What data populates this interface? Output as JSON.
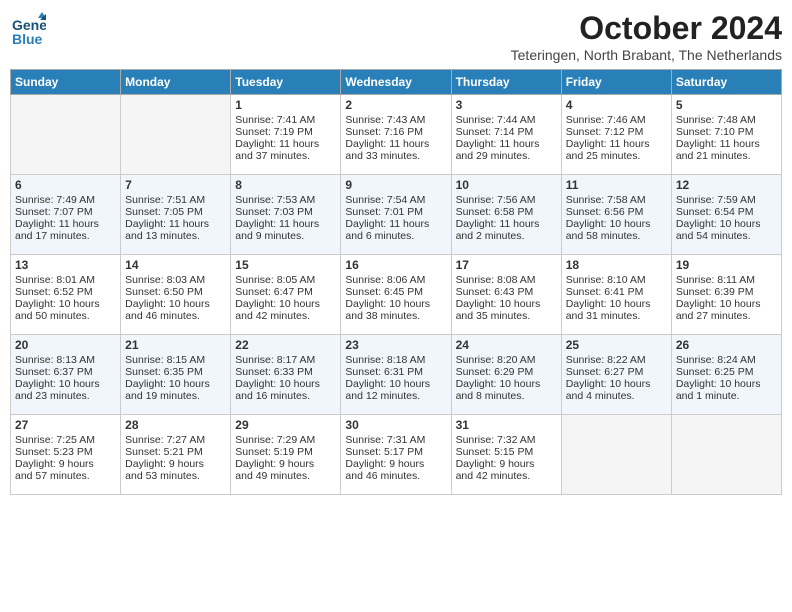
{
  "header": {
    "logo_line1": "General",
    "logo_line2": "Blue",
    "month": "October 2024",
    "location": "Teteringen, North Brabant, The Netherlands"
  },
  "days_of_week": [
    "Sunday",
    "Monday",
    "Tuesday",
    "Wednesday",
    "Thursday",
    "Friday",
    "Saturday"
  ],
  "weeks": [
    [
      {
        "day": "",
        "content": ""
      },
      {
        "day": "",
        "content": ""
      },
      {
        "day": "1",
        "content": "Sunrise: 7:41 AM\nSunset: 7:19 PM\nDaylight: 11 hours\nand 37 minutes."
      },
      {
        "day": "2",
        "content": "Sunrise: 7:43 AM\nSunset: 7:16 PM\nDaylight: 11 hours\nand 33 minutes."
      },
      {
        "day": "3",
        "content": "Sunrise: 7:44 AM\nSunset: 7:14 PM\nDaylight: 11 hours\nand 29 minutes."
      },
      {
        "day": "4",
        "content": "Sunrise: 7:46 AM\nSunset: 7:12 PM\nDaylight: 11 hours\nand 25 minutes."
      },
      {
        "day": "5",
        "content": "Sunrise: 7:48 AM\nSunset: 7:10 PM\nDaylight: 11 hours\nand 21 minutes."
      }
    ],
    [
      {
        "day": "6",
        "content": "Sunrise: 7:49 AM\nSunset: 7:07 PM\nDaylight: 11 hours\nand 17 minutes."
      },
      {
        "day": "7",
        "content": "Sunrise: 7:51 AM\nSunset: 7:05 PM\nDaylight: 11 hours\nand 13 minutes."
      },
      {
        "day": "8",
        "content": "Sunrise: 7:53 AM\nSunset: 7:03 PM\nDaylight: 11 hours\nand 9 minutes."
      },
      {
        "day": "9",
        "content": "Sunrise: 7:54 AM\nSunset: 7:01 PM\nDaylight: 11 hours\nand 6 minutes."
      },
      {
        "day": "10",
        "content": "Sunrise: 7:56 AM\nSunset: 6:58 PM\nDaylight: 11 hours\nand 2 minutes."
      },
      {
        "day": "11",
        "content": "Sunrise: 7:58 AM\nSunset: 6:56 PM\nDaylight: 10 hours\nand 58 minutes."
      },
      {
        "day": "12",
        "content": "Sunrise: 7:59 AM\nSunset: 6:54 PM\nDaylight: 10 hours\nand 54 minutes."
      }
    ],
    [
      {
        "day": "13",
        "content": "Sunrise: 8:01 AM\nSunset: 6:52 PM\nDaylight: 10 hours\nand 50 minutes."
      },
      {
        "day": "14",
        "content": "Sunrise: 8:03 AM\nSunset: 6:50 PM\nDaylight: 10 hours\nand 46 minutes."
      },
      {
        "day": "15",
        "content": "Sunrise: 8:05 AM\nSunset: 6:47 PM\nDaylight: 10 hours\nand 42 minutes."
      },
      {
        "day": "16",
        "content": "Sunrise: 8:06 AM\nSunset: 6:45 PM\nDaylight: 10 hours\nand 38 minutes."
      },
      {
        "day": "17",
        "content": "Sunrise: 8:08 AM\nSunset: 6:43 PM\nDaylight: 10 hours\nand 35 minutes."
      },
      {
        "day": "18",
        "content": "Sunrise: 8:10 AM\nSunset: 6:41 PM\nDaylight: 10 hours\nand 31 minutes."
      },
      {
        "day": "19",
        "content": "Sunrise: 8:11 AM\nSunset: 6:39 PM\nDaylight: 10 hours\nand 27 minutes."
      }
    ],
    [
      {
        "day": "20",
        "content": "Sunrise: 8:13 AM\nSunset: 6:37 PM\nDaylight: 10 hours\nand 23 minutes."
      },
      {
        "day": "21",
        "content": "Sunrise: 8:15 AM\nSunset: 6:35 PM\nDaylight: 10 hours\nand 19 minutes."
      },
      {
        "day": "22",
        "content": "Sunrise: 8:17 AM\nSunset: 6:33 PM\nDaylight: 10 hours\nand 16 minutes."
      },
      {
        "day": "23",
        "content": "Sunrise: 8:18 AM\nSunset: 6:31 PM\nDaylight: 10 hours\nand 12 minutes."
      },
      {
        "day": "24",
        "content": "Sunrise: 8:20 AM\nSunset: 6:29 PM\nDaylight: 10 hours\nand 8 minutes."
      },
      {
        "day": "25",
        "content": "Sunrise: 8:22 AM\nSunset: 6:27 PM\nDaylight: 10 hours\nand 4 minutes."
      },
      {
        "day": "26",
        "content": "Sunrise: 8:24 AM\nSunset: 6:25 PM\nDaylight: 10 hours\nand 1 minute."
      }
    ],
    [
      {
        "day": "27",
        "content": "Sunrise: 7:25 AM\nSunset: 5:23 PM\nDaylight: 9 hours\nand 57 minutes."
      },
      {
        "day": "28",
        "content": "Sunrise: 7:27 AM\nSunset: 5:21 PM\nDaylight: 9 hours\nand 53 minutes."
      },
      {
        "day": "29",
        "content": "Sunrise: 7:29 AM\nSunset: 5:19 PM\nDaylight: 9 hours\nand 49 minutes."
      },
      {
        "day": "30",
        "content": "Sunrise: 7:31 AM\nSunset: 5:17 PM\nDaylight: 9 hours\nand 46 minutes."
      },
      {
        "day": "31",
        "content": "Sunrise: 7:32 AM\nSunset: 5:15 PM\nDaylight: 9 hours\nand 42 minutes."
      },
      {
        "day": "",
        "content": ""
      },
      {
        "day": "",
        "content": ""
      }
    ]
  ]
}
